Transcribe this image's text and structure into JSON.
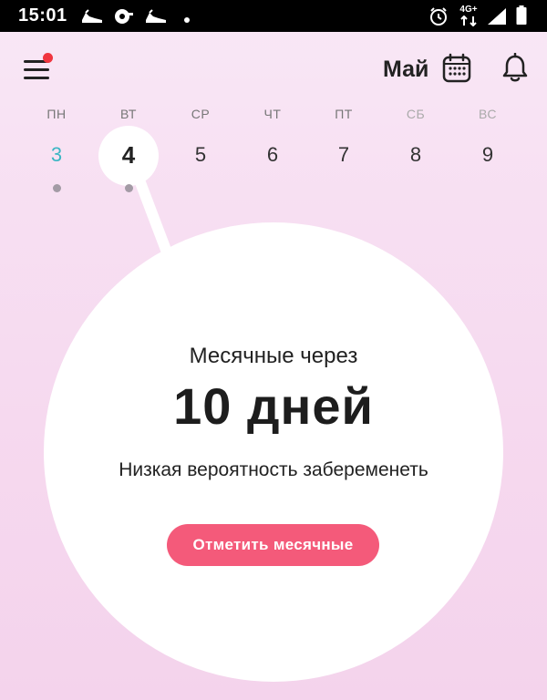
{
  "status_bar": {
    "time": "15:01",
    "icons": [
      "shoe-icon",
      "tools-icon",
      "shoe-icon",
      "dot-icon",
      "alarm-icon",
      "network-4g-icon",
      "signal-icon",
      "battery-icon"
    ],
    "network_label": "4G+"
  },
  "header": {
    "month": "Май",
    "menu_icon": "hamburger-menu-icon",
    "calendar_icon": "calendar-icon",
    "bell_icon": "bell-icon",
    "notification_color": "#f0353f"
  },
  "week": {
    "days": [
      {
        "name": "ПН",
        "number": "3"
      },
      {
        "name": "ВТ",
        "number": "4"
      },
      {
        "name": "СР",
        "number": "5"
      },
      {
        "name": "ЧТ",
        "number": "6"
      },
      {
        "name": "ПТ",
        "number": "7"
      },
      {
        "name": "СБ",
        "number": "8"
      },
      {
        "name": "ВС",
        "number": "9"
      }
    ]
  },
  "card": {
    "subtitle": "Месячные через",
    "days_count": "10 дней",
    "probability": "Низкая вероятность забеременеть",
    "button_label": "Отметить месячные"
  },
  "colors": {
    "accent": "#f45a7a",
    "today": "#3bb6c3",
    "background": "#f7dff2"
  }
}
